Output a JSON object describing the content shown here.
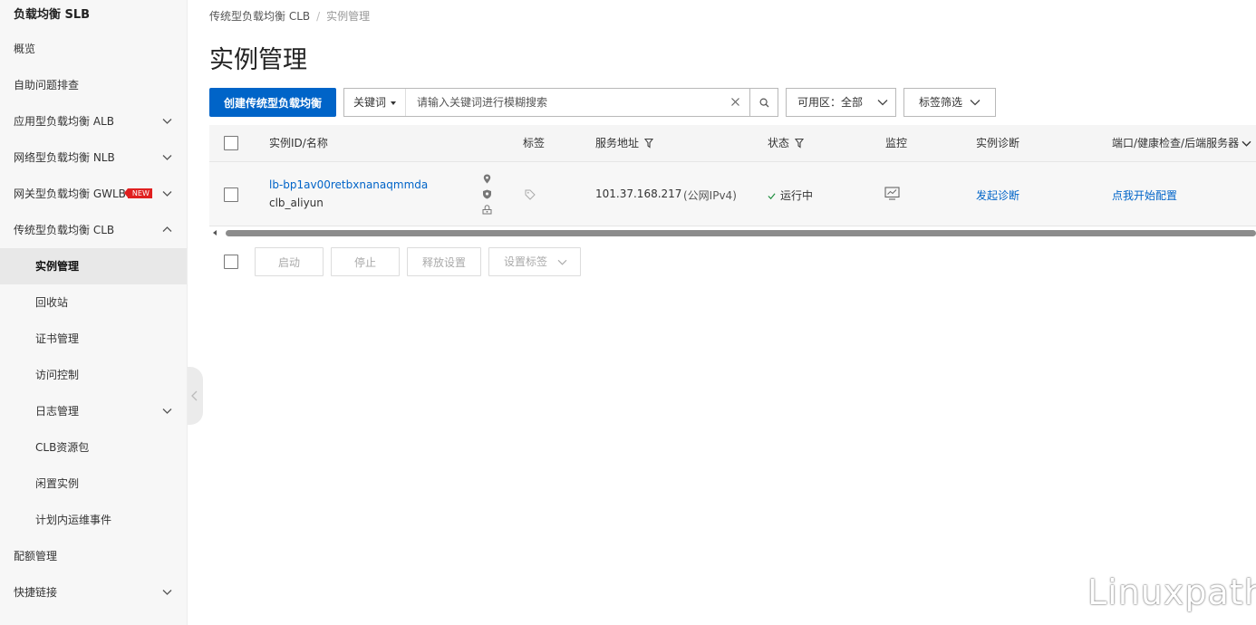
{
  "sidebar": {
    "title": "负载均衡 SLB",
    "items": [
      {
        "label": "概览"
      },
      {
        "label": "自助问题排查"
      },
      {
        "label": "应用型负载均衡 ALB"
      },
      {
        "label": "网络型负载均衡 NLB"
      },
      {
        "label": "网关型负载均衡 GWLB",
        "badge": "NEW"
      },
      {
        "label": "传统型负载均衡 CLB"
      },
      {
        "label": "实例管理"
      },
      {
        "label": "回收站"
      },
      {
        "label": "证书管理"
      },
      {
        "label": "访问控制"
      },
      {
        "label": "日志管理"
      },
      {
        "label": "CLB资源包"
      },
      {
        "label": "闲置实例"
      },
      {
        "label": "计划内运维事件"
      },
      {
        "label": "配额管理"
      },
      {
        "label": "快捷链接"
      }
    ]
  },
  "breadcrumb": {
    "parent": "传统型负载均衡 CLB",
    "current": "实例管理"
  },
  "page_title": "实例管理",
  "toolbar": {
    "create_label": "创建传统型负载均衡",
    "search_field": "关键词",
    "search_placeholder": "请输入关键词进行模糊搜索",
    "zone_label": "可用区：全部",
    "tag_filter_label": "标签筛选"
  },
  "table": {
    "headers": {
      "instance": "实例ID/名称",
      "tags": "标签",
      "address": "服务地址",
      "status": "状态",
      "monitor": "监控",
      "diagnose": "实例诊断",
      "ports": "端口/健康检查/后端服务器"
    },
    "rows": [
      {
        "id": "lb-bp1av00retbxnanaqmmda",
        "name": "clb_aliyun",
        "ip": "101.37.168.217",
        "network": "(公网IPv4)",
        "status": "运行中",
        "diagnose": "发起诊断",
        "ports": "点我开始配置"
      }
    ]
  },
  "actions": {
    "start": "启动",
    "stop": "停止",
    "release": "释放设置",
    "set_tags": "设置标签"
  },
  "watermark": "Linuxpath",
  "colors": {
    "primary": "#0064c8",
    "success": "#1e8e3e",
    "badge": "#e02020"
  }
}
